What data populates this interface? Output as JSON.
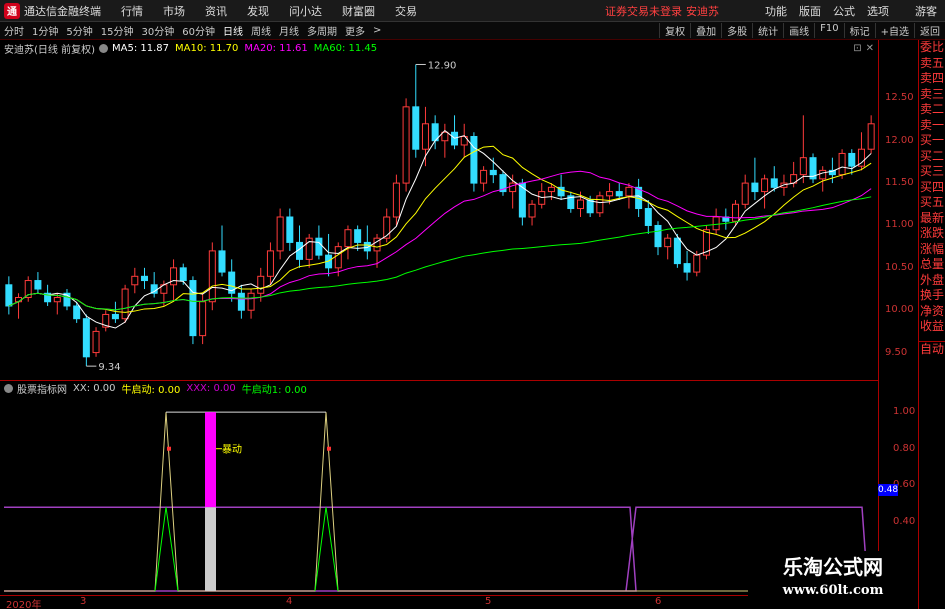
{
  "menubar": {
    "app_title": "通达信金融终端",
    "items": [
      "行情",
      "市场",
      "资讯",
      "发现",
      "问小达",
      "财富圈",
      "交易"
    ],
    "warning": "证券交易未登录",
    "stock_name": "安迪苏",
    "right_items": [
      "功能",
      "版面",
      "公式",
      "选项"
    ],
    "right_end": "游客"
  },
  "toolbar": {
    "periods": [
      "分时",
      "1分钟",
      "5分钟",
      "15分钟",
      "30分钟",
      "60分钟",
      "日线",
      "周线",
      "月线",
      "多周期",
      "更多"
    ],
    "active": "日线",
    "right_tools": [
      "复权",
      "叠加",
      "多股",
      "统计",
      "画线",
      "F10",
      "标记",
      "+自选",
      "返回"
    ]
  },
  "info": {
    "title": "安迪苏(日线 前复权)",
    "ma5": "MA5: 11.87",
    "ma10": "MA10: 11.70",
    "ma20": "MA20: 11.61",
    "ma60": "MA60: 11.45",
    "colors": {
      "ma5": "#ffffff",
      "ma10": "#ffff00",
      "ma20": "#ff00ff",
      "ma60": "#00ff00"
    }
  },
  "price_axis": [
    "12.50",
    "12.00",
    "11.50",
    "11.00",
    "10.50",
    "10.00",
    "9.50"
  ],
  "high_label": "12.90",
  "low_label": "9.34",
  "sub_info": {
    "name": "股票指标网",
    "xx": "XX: 0.00",
    "niu": "牛启动: 0.00",
    "xxx": "XXX: 0.00",
    "niu1": "牛启动1: 0.00"
  },
  "sub_axis": [
    "1.00",
    "0.80",
    "0.60",
    "0.40"
  ],
  "sub_tag": "0.48",
  "burst_label": "暴动",
  "date_axis": [
    "2020年",
    "3",
    "4",
    "5",
    "6"
  ],
  "right_side": [
    "委比",
    "卖五",
    "卖四",
    "卖三",
    "卖二",
    "卖一",
    "买一",
    "买二",
    "买三",
    "买四",
    "买五",
    "最新",
    "涨跌",
    "涨幅",
    "总量",
    "外盘",
    "换手",
    "净资",
    "收益"
  ],
  "right_auto": "自动",
  "watermark": {
    "line1": "乐淘公式网",
    "line2": "www.60lt.com"
  },
  "chart_data": {
    "type": "candlestick",
    "ylim": [
      9.2,
      13.0
    ],
    "candles": [
      [
        10.3,
        10.4,
        9.95,
        10.05
      ],
      [
        10.1,
        10.2,
        9.9,
        10.15
      ],
      [
        10.15,
        10.4,
        10.1,
        10.35
      ],
      [
        10.35,
        10.45,
        10.2,
        10.25
      ],
      [
        10.2,
        10.3,
        10.05,
        10.1
      ],
      [
        10.1,
        10.2,
        9.95,
        10.15
      ],
      [
        10.2,
        10.25,
        10.0,
        10.05
      ],
      [
        10.05,
        10.1,
        9.85,
        9.9
      ],
      [
        9.9,
        9.95,
        9.34,
        9.45
      ],
      [
        9.5,
        9.8,
        9.45,
        9.75
      ],
      [
        9.8,
        10.0,
        9.75,
        9.95
      ],
      [
        9.95,
        10.1,
        9.85,
        9.9
      ],
      [
        9.9,
        10.3,
        9.85,
        10.25
      ],
      [
        10.3,
        10.5,
        10.2,
        10.4
      ],
      [
        10.4,
        10.5,
        10.25,
        10.35
      ],
      [
        10.3,
        10.45,
        10.15,
        10.2
      ],
      [
        10.2,
        10.35,
        10.05,
        10.3
      ],
      [
        10.3,
        10.6,
        10.1,
        10.5
      ],
      [
        10.5,
        10.55,
        10.3,
        10.35
      ],
      [
        10.35,
        10.4,
        9.6,
        9.7
      ],
      [
        9.7,
        10.2,
        9.6,
        10.1
      ],
      [
        10.1,
        10.8,
        10.0,
        10.7
      ],
      [
        10.7,
        11.0,
        10.4,
        10.45
      ],
      [
        10.45,
        10.6,
        10.1,
        10.2
      ],
      [
        10.2,
        10.3,
        9.9,
        10.0
      ],
      [
        10.0,
        10.25,
        9.9,
        10.2
      ],
      [
        10.2,
        10.5,
        10.1,
        10.4
      ],
      [
        10.4,
        10.8,
        10.3,
        10.7
      ],
      [
        10.7,
        11.2,
        10.6,
        11.1
      ],
      [
        11.1,
        11.2,
        10.7,
        10.8
      ],
      [
        10.8,
        11.0,
        10.5,
        10.6
      ],
      [
        10.6,
        10.9,
        10.5,
        10.85
      ],
      [
        10.85,
        11.0,
        10.6,
        10.65
      ],
      [
        10.65,
        10.9,
        10.4,
        10.5
      ],
      [
        10.5,
        10.8,
        10.4,
        10.75
      ],
      [
        10.75,
        11.0,
        10.6,
        10.95
      ],
      [
        10.95,
        11.0,
        10.7,
        10.8
      ],
      [
        10.8,
        11.0,
        10.6,
        10.7
      ],
      [
        10.7,
        10.9,
        10.5,
        10.85
      ],
      [
        10.85,
        11.2,
        10.8,
        11.1
      ],
      [
        11.1,
        11.6,
        11.0,
        11.5
      ],
      [
        11.5,
        12.5,
        11.4,
        12.4
      ],
      [
        12.4,
        12.9,
        11.8,
        11.9
      ],
      [
        11.9,
        12.4,
        11.7,
        12.2
      ],
      [
        12.2,
        12.3,
        11.9,
        12.0
      ],
      [
        12.0,
        12.2,
        11.8,
        12.1
      ],
      [
        12.1,
        12.3,
        11.9,
        11.95
      ],
      [
        11.95,
        12.2,
        11.8,
        12.05
      ],
      [
        12.05,
        12.1,
        11.4,
        11.5
      ],
      [
        11.5,
        11.7,
        11.4,
        11.65
      ],
      [
        11.65,
        11.8,
        11.5,
        11.6
      ],
      [
        11.6,
        11.65,
        11.35,
        11.4
      ],
      [
        11.4,
        11.6,
        11.2,
        11.5
      ],
      [
        11.5,
        11.55,
        11.0,
        11.1
      ],
      [
        11.1,
        11.3,
        11.0,
        11.25
      ],
      [
        11.25,
        11.5,
        11.2,
        11.4
      ],
      [
        11.4,
        11.5,
        11.3,
        11.45
      ],
      [
        11.45,
        11.6,
        11.3,
        11.35
      ],
      [
        11.35,
        11.4,
        11.15,
        11.2
      ],
      [
        11.2,
        11.4,
        11.1,
        11.3
      ],
      [
        11.3,
        11.35,
        11.1,
        11.15
      ],
      [
        11.15,
        11.4,
        11.1,
        11.35
      ],
      [
        11.35,
        11.5,
        11.25,
        11.4
      ],
      [
        11.4,
        11.5,
        11.3,
        11.35
      ],
      [
        11.35,
        11.5,
        11.2,
        11.45
      ],
      [
        11.45,
        11.55,
        11.1,
        11.2
      ],
      [
        11.2,
        11.3,
        10.9,
        11.0
      ],
      [
        11.0,
        11.05,
        10.65,
        10.75
      ],
      [
        10.75,
        10.9,
        10.6,
        10.85
      ],
      [
        10.85,
        10.9,
        10.5,
        10.55
      ],
      [
        10.55,
        10.7,
        10.35,
        10.45
      ],
      [
        10.45,
        10.7,
        10.4,
        10.65
      ],
      [
        10.65,
        11.0,
        10.6,
        10.95
      ],
      [
        10.95,
        11.2,
        10.9,
        11.1
      ],
      [
        11.1,
        11.2,
        10.95,
        11.05
      ],
      [
        11.05,
        11.3,
        11.0,
        11.25
      ],
      [
        11.25,
        11.6,
        11.2,
        11.5
      ],
      [
        11.5,
        11.8,
        11.3,
        11.4
      ],
      [
        11.4,
        11.6,
        11.2,
        11.55
      ],
      [
        11.55,
        11.7,
        11.4,
        11.45
      ],
      [
        11.45,
        11.6,
        11.35,
        11.5
      ],
      [
        11.5,
        11.75,
        11.45,
        11.6
      ],
      [
        11.6,
        12.3,
        11.5,
        11.8
      ],
      [
        11.8,
        11.85,
        11.5,
        11.55
      ],
      [
        11.55,
        11.7,
        11.4,
        11.65
      ],
      [
        11.65,
        11.8,
        11.5,
        11.6
      ],
      [
        11.6,
        11.9,
        11.55,
        11.85
      ],
      [
        11.85,
        11.9,
        11.6,
        11.7
      ],
      [
        11.7,
        12.1,
        11.65,
        11.9
      ],
      [
        11.9,
        12.3,
        11.85,
        12.2
      ]
    ]
  }
}
